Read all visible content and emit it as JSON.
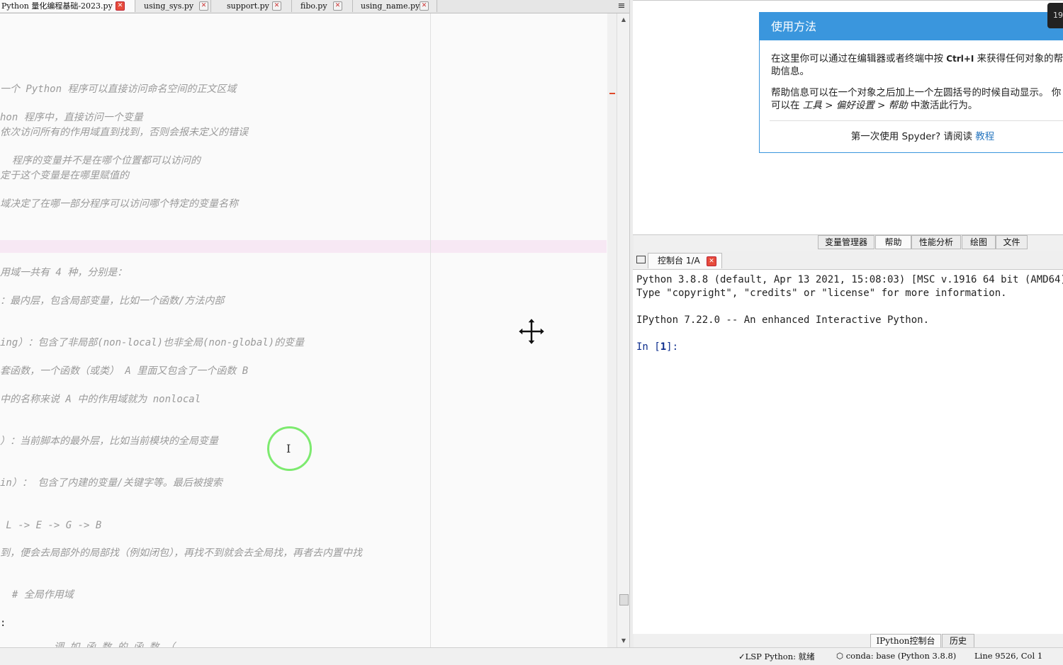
{
  "editor_tabs": [
    {
      "label": "Python 量化编程基础-2023.py",
      "active": true
    },
    {
      "label": "using_sys.py",
      "active": false
    },
    {
      "label": "support.py",
      "active": false
    },
    {
      "label": "fibo.py",
      "active": false
    },
    {
      "label": "using_name.py",
      "active": false
    }
  ],
  "editor": {
    "lines": [
      "一个 Python 程序可以直接访问命名空间的正文区域",
      "hon 程序中，直接访问一个变量",
      "依次访问所有的作用域直到找到，否则会报未定义的错误",
      "  程序的变量并不是在哪个位置都可以访问的",
      "定于这个变量是在哪里赋值的",
      "域决定了在哪一部分程序可以访问哪个特定的变量名称",
      "用域一共有 4 种，分别是：",
      "：最内层，包含局部变量，比如一个函数/方法内部",
      "ing）：包含了非局部(non-local)也非全局(non-global)的变量",
      "套函数，一个函数（或类） A 里面又包含了一个函数 B",
      "中的名称来说 A 中的作用域就为 nonlocal",
      "）：当前脚本的最外层，比如当前模块的全局变量",
      "in）： 包含了内建的变量/关键字等。最后被搜索",
      " L -> E -> G -> B",
      "到，便会去局部外的局部找（例如闭包），再找不到就会去全局找，再者去内置中找",
      "  # 全局作用域",
      ":",
      "      __ 调 如 函 数 的 函 数 （"
    ]
  },
  "help": {
    "title": "使用方法",
    "p1_pre": "在这里你可以通过在编辑器或者终端中按 ",
    "p1_key": "Ctrl+I",
    "p1_post": " 来获得任何对象的帮助信息。",
    "p2_pre": "帮助信息可以在一个对象之后加上一个左圆括号的时候自动显示。 你可以在 ",
    "p2_path": "工具 > 偏好设置 > 帮助",
    "p2_post": " 中激活此行为。",
    "footer_pre": "第一次使用 Spyder? 请阅读 ",
    "footer_link": "教程",
    "badge": "19"
  },
  "pane_tabs": [
    {
      "label": "变量管理器",
      "active": false
    },
    {
      "label": "帮助",
      "active": true
    },
    {
      "label": "性能分析",
      "active": false
    },
    {
      "label": "绘图",
      "active": false
    },
    {
      "label": "文件",
      "active": false
    }
  ],
  "console": {
    "tab_label": "控制台 1/A",
    "lines": [
      "Python 3.8.8 (default, Apr 13 2021, 15:08:03) [MSC v.1916 64 bit (AMD64)]",
      "Type \"copyright\", \"credits\" or \"license\" for more information.",
      "",
      "IPython 7.22.0 -- An enhanced Interactive Python.",
      "",
      "In [1]:"
    ],
    "prompt_pre": "In [",
    "prompt_num": "1",
    "prompt_post": "]:"
  },
  "bottom_tabs": [
    {
      "label": "IPython控制台",
      "active": true
    },
    {
      "label": "历史",
      "active": false
    }
  ],
  "status": {
    "lsp": "LSP Python: 就绪",
    "conda": "conda: base (Python 3.8.8)",
    "position": "Line 9526, Col 1"
  }
}
